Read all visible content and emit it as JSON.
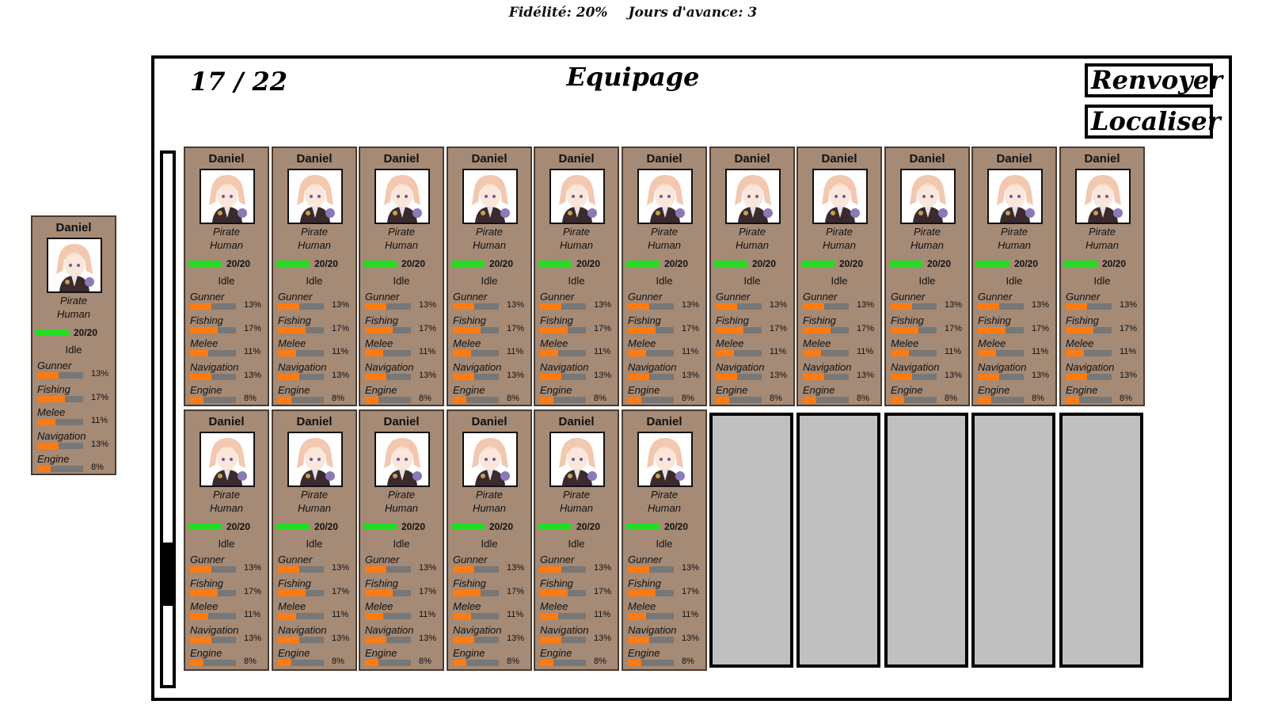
{
  "topbar": {
    "loyalty": "Fidélité: 20%",
    "days_ahead": "Jours d'avance: 3"
  },
  "crew_panel": {
    "count": "17 / 22",
    "title": "Equipage",
    "dismiss_label": "Renvoyer",
    "locate_label": "Localiser",
    "scroll_position": 0.83,
    "empty_slots": 5
  },
  "selected_crew": {
    "name": "Daniel",
    "role": "Pirate",
    "race": "Human",
    "hp": "20/20",
    "status": "Idle",
    "skills": [
      {
        "name": "Gunner",
        "pct": "13%",
        "value": 0.13
      },
      {
        "name": "Fishing",
        "pct": "17%",
        "value": 0.17
      },
      {
        "name": "Melee",
        "pct": "11%",
        "value": 0.11
      },
      {
        "name": "Navigation",
        "pct": "13%",
        "value": 0.13
      },
      {
        "name": "Engine",
        "pct": "8%",
        "value": 0.08
      }
    ]
  },
  "crew": [
    {
      "name": "Daniel",
      "role": "Pirate",
      "race": "Human",
      "hp": "20/20",
      "status": "Idle",
      "skills": [
        {
          "name": "Gunner",
          "pct": "13%",
          "value": 0.13
        },
        {
          "name": "Fishing",
          "pct": "17%",
          "value": 0.17
        },
        {
          "name": "Melee",
          "pct": "11%",
          "value": 0.11
        },
        {
          "name": "Navigation",
          "pct": "13%",
          "value": 0.13
        },
        {
          "name": "Engine",
          "pct": "8%",
          "value": 0.08
        }
      ]
    },
    {
      "name": "Daniel",
      "role": "Pirate",
      "race": "Human",
      "hp": "20/20",
      "status": "Idle",
      "skills": [
        {
          "name": "Gunner",
          "pct": "13%",
          "value": 0.13
        },
        {
          "name": "Fishing",
          "pct": "17%",
          "value": 0.17
        },
        {
          "name": "Melee",
          "pct": "11%",
          "value": 0.11
        },
        {
          "name": "Navigation",
          "pct": "13%",
          "value": 0.13
        },
        {
          "name": "Engine",
          "pct": "8%",
          "value": 0.08
        }
      ]
    },
    {
      "name": "Daniel",
      "role": "Pirate",
      "race": "Human",
      "hp": "20/20",
      "status": "Idle",
      "skills": [
        {
          "name": "Gunner",
          "pct": "13%",
          "value": 0.13
        },
        {
          "name": "Fishing",
          "pct": "17%",
          "value": 0.17
        },
        {
          "name": "Melee",
          "pct": "11%",
          "value": 0.11
        },
        {
          "name": "Navigation",
          "pct": "13%",
          "value": 0.13
        },
        {
          "name": "Engine",
          "pct": "8%",
          "value": 0.08
        }
      ]
    },
    {
      "name": "Daniel",
      "role": "Pirate",
      "race": "Human",
      "hp": "20/20",
      "status": "Idle",
      "skills": [
        {
          "name": "Gunner",
          "pct": "13%",
          "value": 0.13
        },
        {
          "name": "Fishing",
          "pct": "17%",
          "value": 0.17
        },
        {
          "name": "Melee",
          "pct": "11%",
          "value": 0.11
        },
        {
          "name": "Navigation",
          "pct": "13%",
          "value": 0.13
        },
        {
          "name": "Engine",
          "pct": "8%",
          "value": 0.08
        }
      ]
    },
    {
      "name": "Daniel",
      "role": "Pirate",
      "race": "Human",
      "hp": "20/20",
      "status": "Idle",
      "skills": [
        {
          "name": "Gunner",
          "pct": "13%",
          "value": 0.13
        },
        {
          "name": "Fishing",
          "pct": "17%",
          "value": 0.17
        },
        {
          "name": "Melee",
          "pct": "11%",
          "value": 0.11
        },
        {
          "name": "Navigation",
          "pct": "13%",
          "value": 0.13
        },
        {
          "name": "Engine",
          "pct": "8%",
          "value": 0.08
        }
      ]
    },
    {
      "name": "Daniel",
      "role": "Pirate",
      "race": "Human",
      "hp": "20/20",
      "status": "Idle",
      "skills": [
        {
          "name": "Gunner",
          "pct": "13%",
          "value": 0.13
        },
        {
          "name": "Fishing",
          "pct": "17%",
          "value": 0.17
        },
        {
          "name": "Melee",
          "pct": "11%",
          "value": 0.11
        },
        {
          "name": "Navigation",
          "pct": "13%",
          "value": 0.13
        },
        {
          "name": "Engine",
          "pct": "8%",
          "value": 0.08
        }
      ]
    },
    {
      "name": "Daniel",
      "role": "Pirate",
      "race": "Human",
      "hp": "20/20",
      "status": "Idle",
      "skills": [
        {
          "name": "Gunner",
          "pct": "13%",
          "value": 0.13
        },
        {
          "name": "Fishing",
          "pct": "17%",
          "value": 0.17
        },
        {
          "name": "Melee",
          "pct": "11%",
          "value": 0.11
        },
        {
          "name": "Navigation",
          "pct": "13%",
          "value": 0.13
        },
        {
          "name": "Engine",
          "pct": "8%",
          "value": 0.08
        }
      ]
    },
    {
      "name": "Daniel",
      "role": "Pirate",
      "race": "Human",
      "hp": "20/20",
      "status": "Idle",
      "skills": [
        {
          "name": "Gunner",
          "pct": "13%",
          "value": 0.13
        },
        {
          "name": "Fishing",
          "pct": "17%",
          "value": 0.17
        },
        {
          "name": "Melee",
          "pct": "11%",
          "value": 0.11
        },
        {
          "name": "Navigation",
          "pct": "13%",
          "value": 0.13
        },
        {
          "name": "Engine",
          "pct": "8%",
          "value": 0.08
        }
      ]
    },
    {
      "name": "Daniel",
      "role": "Pirate",
      "race": "Human",
      "hp": "20/20",
      "status": "Idle",
      "skills": [
        {
          "name": "Gunner",
          "pct": "13%",
          "value": 0.13
        },
        {
          "name": "Fishing",
          "pct": "17%",
          "value": 0.17
        },
        {
          "name": "Melee",
          "pct": "11%",
          "value": 0.11
        },
        {
          "name": "Navigation",
          "pct": "13%",
          "value": 0.13
        },
        {
          "name": "Engine",
          "pct": "8%",
          "value": 0.08
        }
      ]
    },
    {
      "name": "Daniel",
      "role": "Pirate",
      "race": "Human",
      "hp": "20/20",
      "status": "Idle",
      "skills": [
        {
          "name": "Gunner",
          "pct": "13%",
          "value": 0.13
        },
        {
          "name": "Fishing",
          "pct": "17%",
          "value": 0.17
        },
        {
          "name": "Melee",
          "pct": "11%",
          "value": 0.11
        },
        {
          "name": "Navigation",
          "pct": "13%",
          "value": 0.13
        },
        {
          "name": "Engine",
          "pct": "8%",
          "value": 0.08
        }
      ]
    },
    {
      "name": "Daniel",
      "role": "Pirate",
      "race": "Human",
      "hp": "20/20",
      "status": "Idle",
      "skills": [
        {
          "name": "Gunner",
          "pct": "13%",
          "value": 0.13
        },
        {
          "name": "Fishing",
          "pct": "17%",
          "value": 0.17
        },
        {
          "name": "Melee",
          "pct": "11%",
          "value": 0.11
        },
        {
          "name": "Navigation",
          "pct": "13%",
          "value": 0.13
        },
        {
          "name": "Engine",
          "pct": "8%",
          "value": 0.08
        }
      ]
    },
    {
      "name": "Daniel",
      "role": "Pirate",
      "race": "Human",
      "hp": "20/20",
      "status": "Idle",
      "skills": [
        {
          "name": "Gunner",
          "pct": "13%",
          "value": 0.13
        },
        {
          "name": "Fishing",
          "pct": "17%",
          "value": 0.17
        },
        {
          "name": "Melee",
          "pct": "11%",
          "value": 0.11
        },
        {
          "name": "Navigation",
          "pct": "13%",
          "value": 0.13
        },
        {
          "name": "Engine",
          "pct": "8%",
          "value": 0.08
        }
      ]
    },
    {
      "name": "Daniel",
      "role": "Pirate",
      "race": "Human",
      "hp": "20/20",
      "status": "Idle",
      "skills": [
        {
          "name": "Gunner",
          "pct": "13%",
          "value": 0.13
        },
        {
          "name": "Fishing",
          "pct": "17%",
          "value": 0.17
        },
        {
          "name": "Melee",
          "pct": "11%",
          "value": 0.11
        },
        {
          "name": "Navigation",
          "pct": "13%",
          "value": 0.13
        },
        {
          "name": "Engine",
          "pct": "8%",
          "value": 0.08
        }
      ]
    },
    {
      "name": "Daniel",
      "role": "Pirate",
      "race": "Human",
      "hp": "20/20",
      "status": "Idle",
      "skills": [
        {
          "name": "Gunner",
          "pct": "13%",
          "value": 0.13
        },
        {
          "name": "Fishing",
          "pct": "17%",
          "value": 0.17
        },
        {
          "name": "Melee",
          "pct": "11%",
          "value": 0.11
        },
        {
          "name": "Navigation",
          "pct": "13%",
          "value": 0.13
        },
        {
          "name": "Engine",
          "pct": "8%",
          "value": 0.08
        }
      ]
    },
    {
      "name": "Daniel",
      "role": "Pirate",
      "race": "Human",
      "hp": "20/20",
      "status": "Idle",
      "skills": [
        {
          "name": "Gunner",
          "pct": "13%",
          "value": 0.13
        },
        {
          "name": "Fishing",
          "pct": "17%",
          "value": 0.17
        },
        {
          "name": "Melee",
          "pct": "11%",
          "value": 0.11
        },
        {
          "name": "Navigation",
          "pct": "13%",
          "value": 0.13
        },
        {
          "name": "Engine",
          "pct": "8%",
          "value": 0.08
        }
      ]
    },
    {
      "name": "Daniel",
      "role": "Pirate",
      "race": "Human",
      "hp": "20/20",
      "status": "Idle",
      "skills": [
        {
          "name": "Gunner",
          "pct": "13%",
          "value": 0.13
        },
        {
          "name": "Fishing",
          "pct": "17%",
          "value": 0.17
        },
        {
          "name": "Melee",
          "pct": "11%",
          "value": 0.11
        },
        {
          "name": "Navigation",
          "pct": "13%",
          "value": 0.13
        },
        {
          "name": "Engine",
          "pct": "8%",
          "value": 0.08
        }
      ]
    },
    {
      "name": "Daniel",
      "role": "Pirate",
      "race": "Human",
      "hp": "20/20",
      "status": "Idle",
      "skills": [
        {
          "name": "Gunner",
          "pct": "13%",
          "value": 0.13
        },
        {
          "name": "Fishing",
          "pct": "17%",
          "value": 0.17
        },
        {
          "name": "Melee",
          "pct": "11%",
          "value": 0.11
        },
        {
          "name": "Navigation",
          "pct": "13%",
          "value": 0.13
        },
        {
          "name": "Engine",
          "pct": "8%",
          "value": 0.08
        }
      ]
    }
  ],
  "colors": {
    "card_bg": "#a58a75",
    "hp_bar": "#22dd22",
    "skill_fill": "#ff7a10",
    "skill_track": "#777777",
    "empty_slot": "#c0c0c0"
  },
  "icons": {
    "portrait": "crew-portrait-icon"
  }
}
